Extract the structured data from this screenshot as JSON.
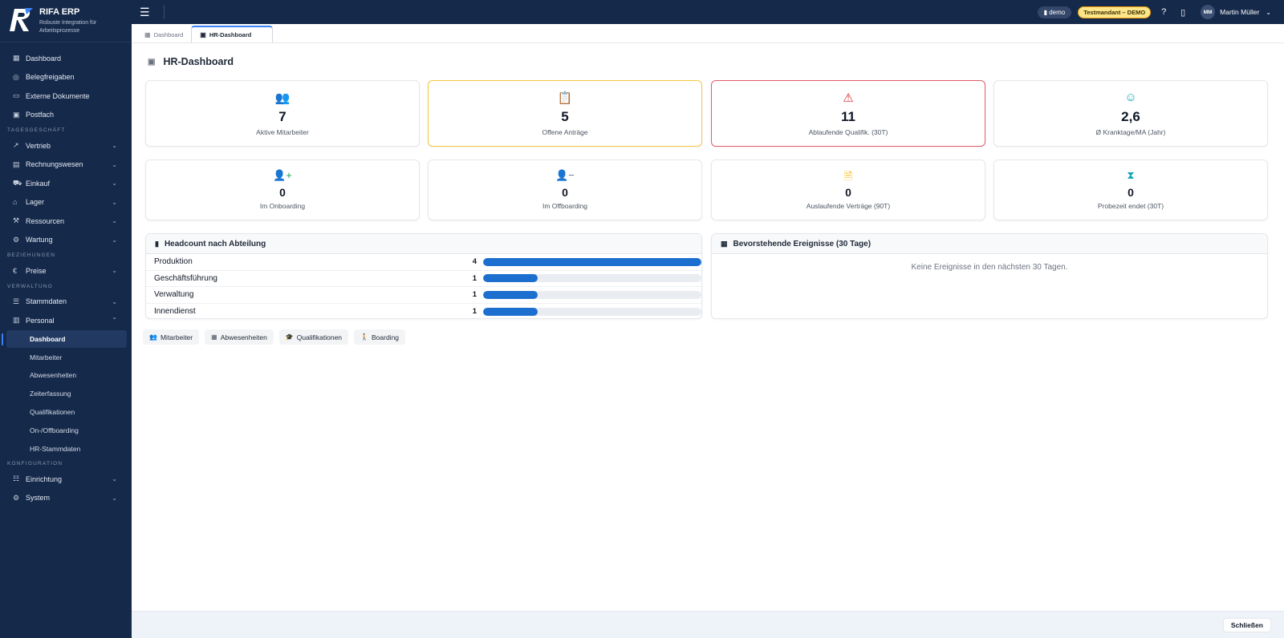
{
  "app": {
    "name": "RIFA ERP",
    "subtitle": "Robuste Integration für Arbeitsprozesse"
  },
  "sidebar": {
    "items_top": [
      {
        "label": "Dashboard",
        "icon": "grid-icon"
      },
      {
        "label": "Belegfreigaben",
        "icon": "check-circle-icon"
      },
      {
        "label": "Externe Dokumente",
        "icon": "folder-icon"
      },
      {
        "label": "Postfach",
        "icon": "inbox-icon"
      }
    ],
    "section_tagesgeschaeft": "TAGESGESCHÄFT",
    "tagesgeschaeft": [
      {
        "label": "Vertrieb",
        "icon": "trend-icon"
      },
      {
        "label": "Rechnungswesen",
        "icon": "receipt-icon"
      },
      {
        "label": "Einkauf",
        "icon": "cart-icon"
      },
      {
        "label": "Lager",
        "icon": "warehouse-icon"
      },
      {
        "label": "Ressourcen",
        "icon": "tools-icon"
      },
      {
        "label": "Wartung",
        "icon": "wrench-icon"
      }
    ],
    "section_beziehungen": "BEZIEHUNGEN",
    "beziehungen": [
      {
        "label": "Preise",
        "icon": "euro-icon"
      }
    ],
    "section_verwaltung": "VERWALTUNG",
    "verwaltung": [
      {
        "label": "Stammdaten",
        "icon": "database-icon"
      },
      {
        "label": "Personal",
        "icon": "briefcase-icon"
      }
    ],
    "personal_sub": [
      "Dashboard",
      "Mitarbeiter",
      "Abwesenheiten",
      "Zeiterfassung",
      "Qualifikationen",
      "On-/Offboarding",
      "HR-Stammdaten"
    ],
    "section_konfiguration": "KONFIGURATION",
    "konfiguration": [
      {
        "label": "Einrichtung",
        "icon": "sliders-icon"
      },
      {
        "label": "System",
        "icon": "gear-icon"
      }
    ]
  },
  "topbar": {
    "tenant": "demo",
    "mandant": "Testmandant – DEMO",
    "user_initials": "MM",
    "user_name": "Martin Müller"
  },
  "tabs": [
    {
      "label": "Dashboard"
    },
    {
      "label": "HR-Dashboard"
    }
  ],
  "page": {
    "title": "HR-Dashboard"
  },
  "kpis": [
    {
      "value": "7",
      "label": "Aktive Mitarbeiter",
      "icon": "users-icon",
      "accent": "#2563eb"
    },
    {
      "value": "5",
      "label": "Offene Anträge",
      "icon": "clipboard-icon",
      "accent": "#f5b400"
    },
    {
      "value": "11",
      "label": "Ablaufende Qualifik. (30T)",
      "icon": "warning-icon",
      "accent": "#dc2626"
    },
    {
      "value": "2,6",
      "label": "Ø Kranktage/MA (Jahr)",
      "icon": "sick-icon",
      "accent": "#0ea5b7"
    },
    {
      "value": "0",
      "label": "Im Onboarding",
      "icon": "user-plus-icon",
      "accent": "#16a34a"
    },
    {
      "value": "0",
      "label": "Im Offboarding",
      "icon": "user-minus-icon",
      "accent": "#6b7280"
    },
    {
      "value": "0",
      "label": "Auslaufende Verträge (90T)",
      "icon": "document-icon",
      "accent": "#f5b400"
    },
    {
      "value": "0",
      "label": "Probezeit endet (30T)",
      "icon": "hourglass-icon",
      "accent": "#0ea5b7"
    }
  ],
  "headcount": {
    "title": "Headcount nach Abteilung",
    "rows": [
      {
        "name": "Produktion",
        "count": "4",
        "fraction": 1.0
      },
      {
        "name": "Geschäftsführung",
        "count": "1",
        "fraction": 0.25
      },
      {
        "name": "Verwaltung",
        "count": "1",
        "fraction": 0.25
      },
      {
        "name": "Innendienst",
        "count": "1",
        "fraction": 0.25
      }
    ]
  },
  "events": {
    "title": "Bevorstehende Ereignisse (30 Tage)",
    "empty": "Keine Ereignisse in den nächsten 30 Tagen."
  },
  "quick_links": [
    "Mitarbeiter",
    "Abwesenheiten",
    "Qualifikationen",
    "Boarding"
  ],
  "footer": {
    "close": "Schließen"
  }
}
